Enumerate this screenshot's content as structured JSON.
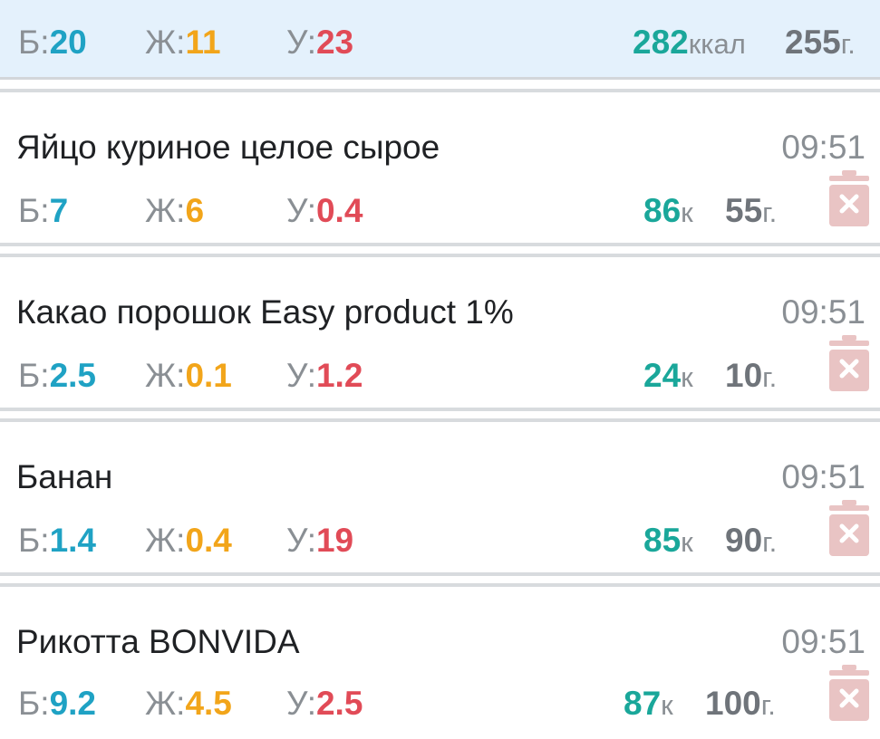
{
  "summary": {
    "protein_label": "Б:",
    "protein_value": "20",
    "fat_label": "Ж:",
    "fat_value": "11",
    "carbs_label": "У:",
    "carbs_value": "23",
    "kcal_value": "282",
    "kcal_unit": "ккал",
    "weight_value": "255",
    "weight_unit": "г."
  },
  "entries": [
    {
      "name": "Яйцо куриное целое сырое",
      "time": "09:51",
      "protein_label": "Б:",
      "protein": "7",
      "fat_label": "Ж:",
      "fat": "6",
      "carbs_label": "У:",
      "carbs": "0.4",
      "kcal": "86",
      "kcal_unit": "к",
      "weight": "55",
      "weight_unit": "г."
    },
    {
      "name": "Какао порошок Easy product 1%",
      "time": "09:51",
      "protein_label": "Б:",
      "protein": "2.5",
      "fat_label": "Ж:",
      "fat": "0.1",
      "carbs_label": "У:",
      "carbs": "1.2",
      "kcal": "24",
      "kcal_unit": "к",
      "weight": "10",
      "weight_unit": "г."
    },
    {
      "name": "Банан",
      "time": "09:51",
      "protein_label": "Б:",
      "protein": "1.4",
      "fat_label": "Ж:",
      "fat": "0.4",
      "carbs_label": "У:",
      "carbs": "19",
      "kcal": "85",
      "kcal_unit": "к",
      "weight": "90",
      "weight_unit": "г."
    },
    {
      "name": "Рикотта BONVIDA",
      "time": "09:51",
      "protein_label": "Б:",
      "protein": "9.2",
      "fat_label": "Ж:",
      "fat": "4.5",
      "carbs_label": "У:",
      "carbs": "2.5",
      "kcal": "87",
      "kcal_unit": "к",
      "weight": "100",
      "weight_unit": "г."
    }
  ],
  "icons": {
    "delete": "trash-icon"
  },
  "colors": {
    "protein": "#1fa2c4",
    "fat": "#f2a51a",
    "carbs": "#e14b57",
    "kcal": "#1aa79a",
    "weight": "#6f747a",
    "summary_bg": "#e4f1fc",
    "trash": "#e9c4c4"
  }
}
